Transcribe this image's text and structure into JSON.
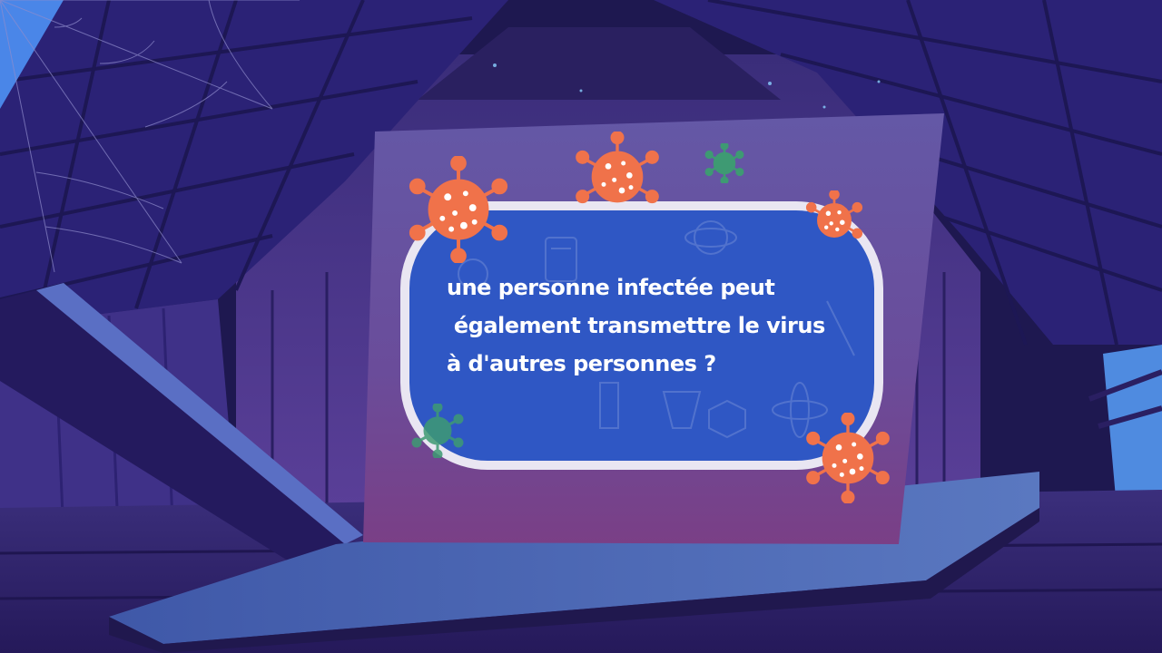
{
  "question": {
    "lines": [
      "une personne infectée peut",
      " également transmettre le virus",
      "à d'autres personnes ?"
    ]
  },
  "colors": {
    "board": "#5d4c9a",
    "bubble": "#2f57c4",
    "bubble_border": "#e9e6f2",
    "virus_orange": "#f0724a",
    "virus_green": "#3e9a73"
  },
  "icons": [
    "virus-icon",
    "cobweb-icon",
    "chemistry-pattern"
  ]
}
